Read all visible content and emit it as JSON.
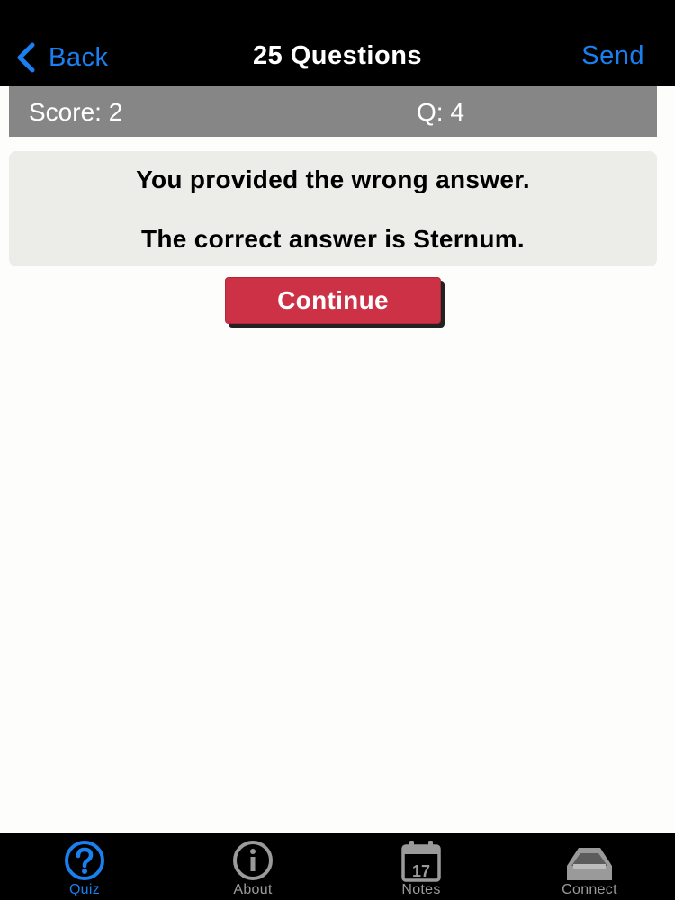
{
  "navbar": {
    "back_label": "Back",
    "title": "25 Questions",
    "send_label": "Send"
  },
  "scorebar": {
    "score": "Score: 2",
    "question": "Q: 4"
  },
  "feedback": {
    "line1": "You provided the wrong answer.",
    "line2": "The correct answer is Sternum."
  },
  "continue_label": "Continue",
  "tabs": [
    {
      "label": "Quiz",
      "icon": "question-icon",
      "active": true
    },
    {
      "label": "About",
      "icon": "info-icon",
      "active": false
    },
    {
      "label": "Notes",
      "icon": "calendar-icon",
      "active": false
    },
    {
      "label": "Connect",
      "icon": "tray-icon",
      "active": false
    }
  ],
  "calendar_day": "17",
  "colors": {
    "accent": "#1a7ff0",
    "button": "#cc3145",
    "scorebar": "#868686",
    "feedback_bg": "#ecece8",
    "inactive_tab": "#9a9a9a"
  }
}
